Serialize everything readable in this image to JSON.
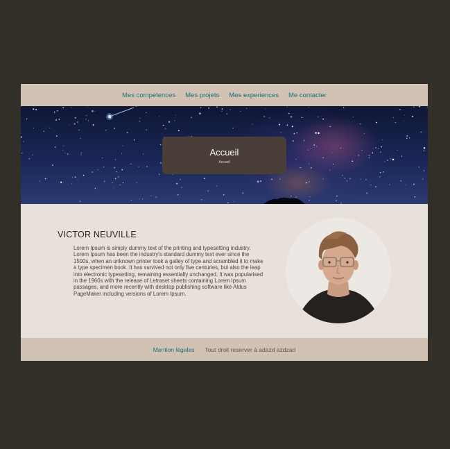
{
  "nav": {
    "items": [
      "Mes competences",
      "Mes projets",
      "Mes experiences",
      "Me contacter"
    ]
  },
  "hero": {
    "title": "Accueil",
    "subtitle": "Accueil"
  },
  "profile": {
    "name": "VICTOR NEUVILLE",
    "bio": "Lorem Ipsum is simply dummy text of the printing and typesetting industry. Lorem Ipsum has been the industry's standard dummy text ever since the 1500s, when an unknown printer took a galley of type and scrambled it to make a type specimen book. It has survived not only five centuries, but also the leap into electronic typesetting, remaining essentially unchanged. It was popularised in the 1960s with the release of Letraset sheets containing Lorem Ipsum passages, and more recently with desktop publishing software like Aldus PageMaker including versions of Lorem Ipsum."
  },
  "footer": {
    "legal": "Mention légales",
    "rights": "Tout droit reserver à adazd azdzad"
  },
  "colors": {
    "background": "#322e28",
    "nav_bar": "#d2c2b3",
    "link": "#1d6f7e",
    "content_bg": "#e8e0db",
    "hero_card": "#4a3f38"
  }
}
